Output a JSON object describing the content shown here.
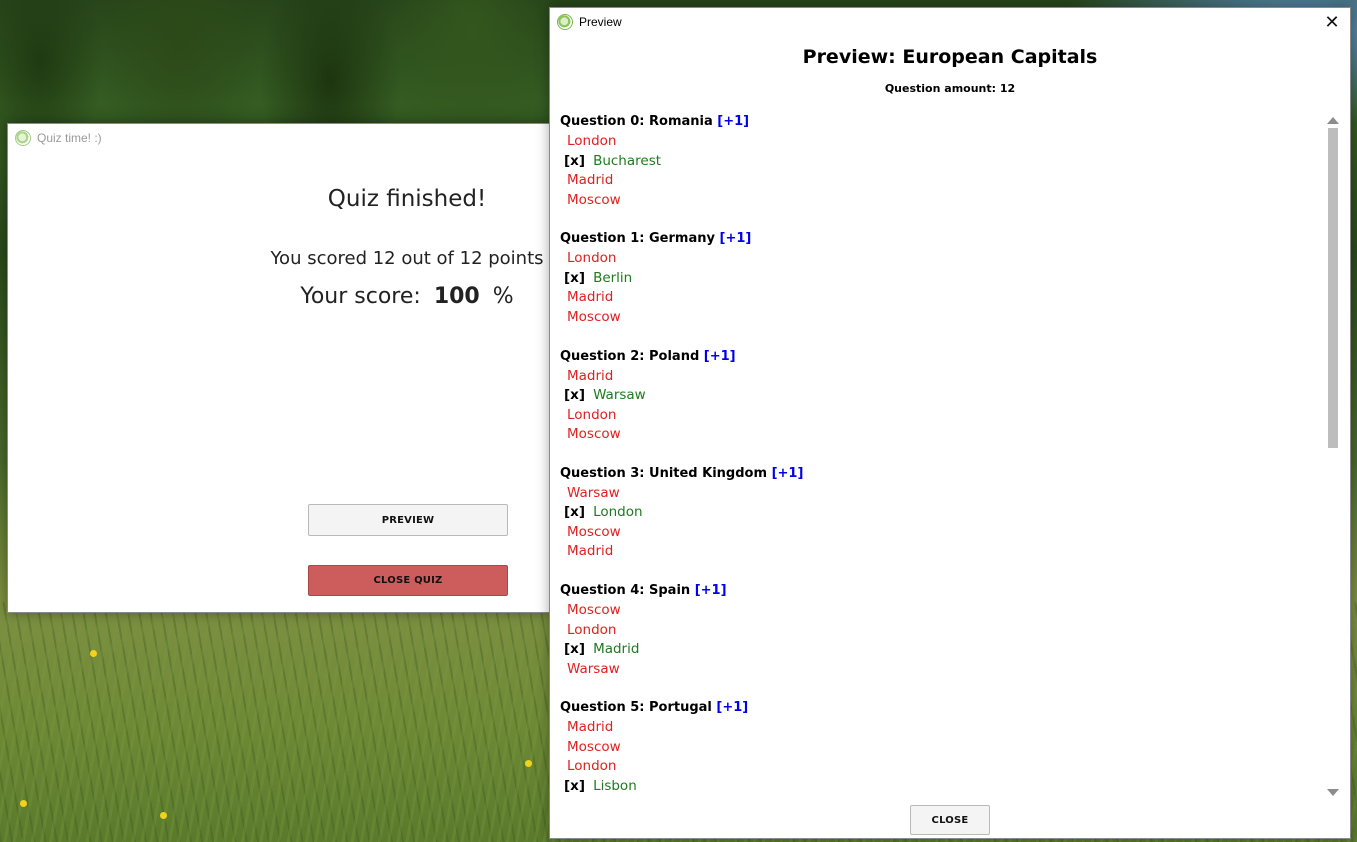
{
  "quiz_window": {
    "title": "Quiz time! :)",
    "heading": "Quiz finished!",
    "scored_text": "You scored 12 out of 12 points",
    "score_label": "Your score:",
    "score_value": "100",
    "score_unit": "%",
    "preview_button": "PREVIEW",
    "close_quiz_button": "CLOSE QUIZ"
  },
  "preview_window": {
    "title": "Preview",
    "close_glyph": "✕",
    "heading": "Preview: European Capitals",
    "question_amount": "Question amount: 12",
    "close_button": "CLOSE",
    "correct_marker": "[x]",
    "questions": [
      {
        "title": "Question 0: Romania",
        "points": "[+1]",
        "answers": [
          {
            "text": "London",
            "correct": false
          },
          {
            "text": "Bucharest",
            "correct": true
          },
          {
            "text": "Madrid",
            "correct": false
          },
          {
            "text": "Moscow",
            "correct": false
          }
        ]
      },
      {
        "title": "Question 1: Germany",
        "points": "[+1]",
        "answers": [
          {
            "text": "London",
            "correct": false
          },
          {
            "text": "Berlin",
            "correct": true
          },
          {
            "text": "Madrid",
            "correct": false
          },
          {
            "text": "Moscow",
            "correct": false
          }
        ]
      },
      {
        "title": "Question 2: Poland",
        "points": "[+1]",
        "answers": [
          {
            "text": "Madrid",
            "correct": false
          },
          {
            "text": "Warsaw",
            "correct": true
          },
          {
            "text": "London",
            "correct": false
          },
          {
            "text": "Moscow",
            "correct": false
          }
        ]
      },
      {
        "title": "Question 3: United Kingdom",
        "points": "[+1]",
        "answers": [
          {
            "text": "Warsaw",
            "correct": false
          },
          {
            "text": "London",
            "correct": true
          },
          {
            "text": "Moscow",
            "correct": false
          },
          {
            "text": "Madrid",
            "correct": false
          }
        ]
      },
      {
        "title": "Question 4: Spain",
        "points": "[+1]",
        "answers": [
          {
            "text": "Moscow",
            "correct": false
          },
          {
            "text": "London",
            "correct": false
          },
          {
            "text": "Madrid",
            "correct": true
          },
          {
            "text": "Warsaw",
            "correct": false
          }
        ]
      },
      {
        "title": "Question 5: Portugal",
        "points": "[+1]",
        "answers": [
          {
            "text": "Madrid",
            "correct": false
          },
          {
            "text": "Moscow",
            "correct": false
          },
          {
            "text": "London",
            "correct": false
          },
          {
            "text": "Lisbon",
            "correct": true
          }
        ]
      }
    ]
  },
  "colors": {
    "correct_answer": "#1f7a1f",
    "wrong_answer": "#e02020",
    "points_badge": "#0000ee",
    "close_quiz_button": "#cd5c5c"
  },
  "icons": {
    "app_icon": "quiz-app-icon",
    "close": "close-icon",
    "scroll_up": "chevron-up-icon",
    "scroll_down": "chevron-down-icon"
  }
}
